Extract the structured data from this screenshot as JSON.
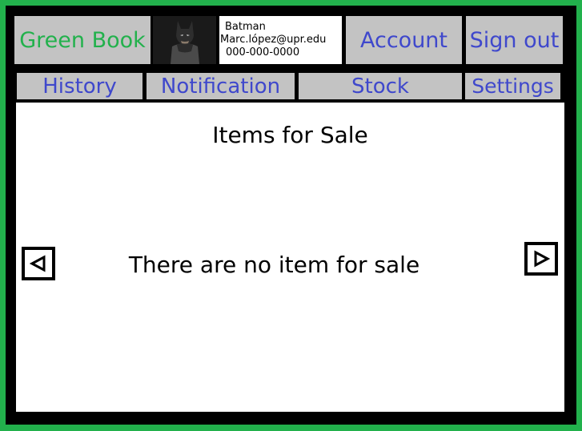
{
  "header": {
    "app_name": "Green Book",
    "account_label": "Account",
    "sign_out_label": "Sign out"
  },
  "user": {
    "name": "Batman",
    "email": "Marc.lópez@upr.edu",
    "phone": "000-000-0000",
    "avatar_icon": "batman-avatar-icon"
  },
  "nav": {
    "history": "History",
    "notification": "Notification",
    "stock": "Stock",
    "settings": "Settings"
  },
  "main": {
    "title": "Items for Sale",
    "empty_message": "There are no item for sale",
    "prev_icon": "left-arrow-icon",
    "next_icon": "right-arrow-icon"
  },
  "colors": {
    "brand_green": "#22b14c",
    "link_blue": "#3f48cc",
    "tile_gray": "#c3c3c3"
  }
}
